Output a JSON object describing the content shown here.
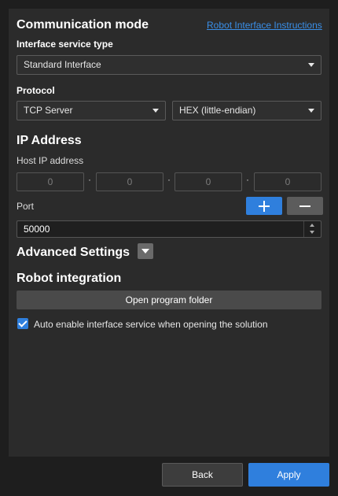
{
  "communication": {
    "title": "Communication mode",
    "instructions_link": "Robot Interface Instructions",
    "service_type_label": "Interface service type",
    "service_type_value": "Standard Interface",
    "protocol_label": "Protocol",
    "protocol_value": "TCP Server",
    "format_value": "HEX (little-endian)"
  },
  "ip": {
    "title": "IP Address",
    "host_label": "Host IP address",
    "octets": [
      "0",
      "0",
      "0",
      "0"
    ],
    "separator": "·",
    "port_label": "Port",
    "port_value": "50000"
  },
  "advanced": {
    "title": "Advanced Settings"
  },
  "robot": {
    "title": "Robot integration",
    "open_folder_label": "Open program folder",
    "auto_enable_label": "Auto enable interface service when opening the solution",
    "auto_enable_checked": true
  },
  "footer": {
    "back_label": "Back",
    "apply_label": "Apply"
  },
  "colors": {
    "accent": "#2f7fdd",
    "link": "#3a8fe8",
    "panel": "#2b2b2b",
    "background": "#1e1e1e"
  }
}
